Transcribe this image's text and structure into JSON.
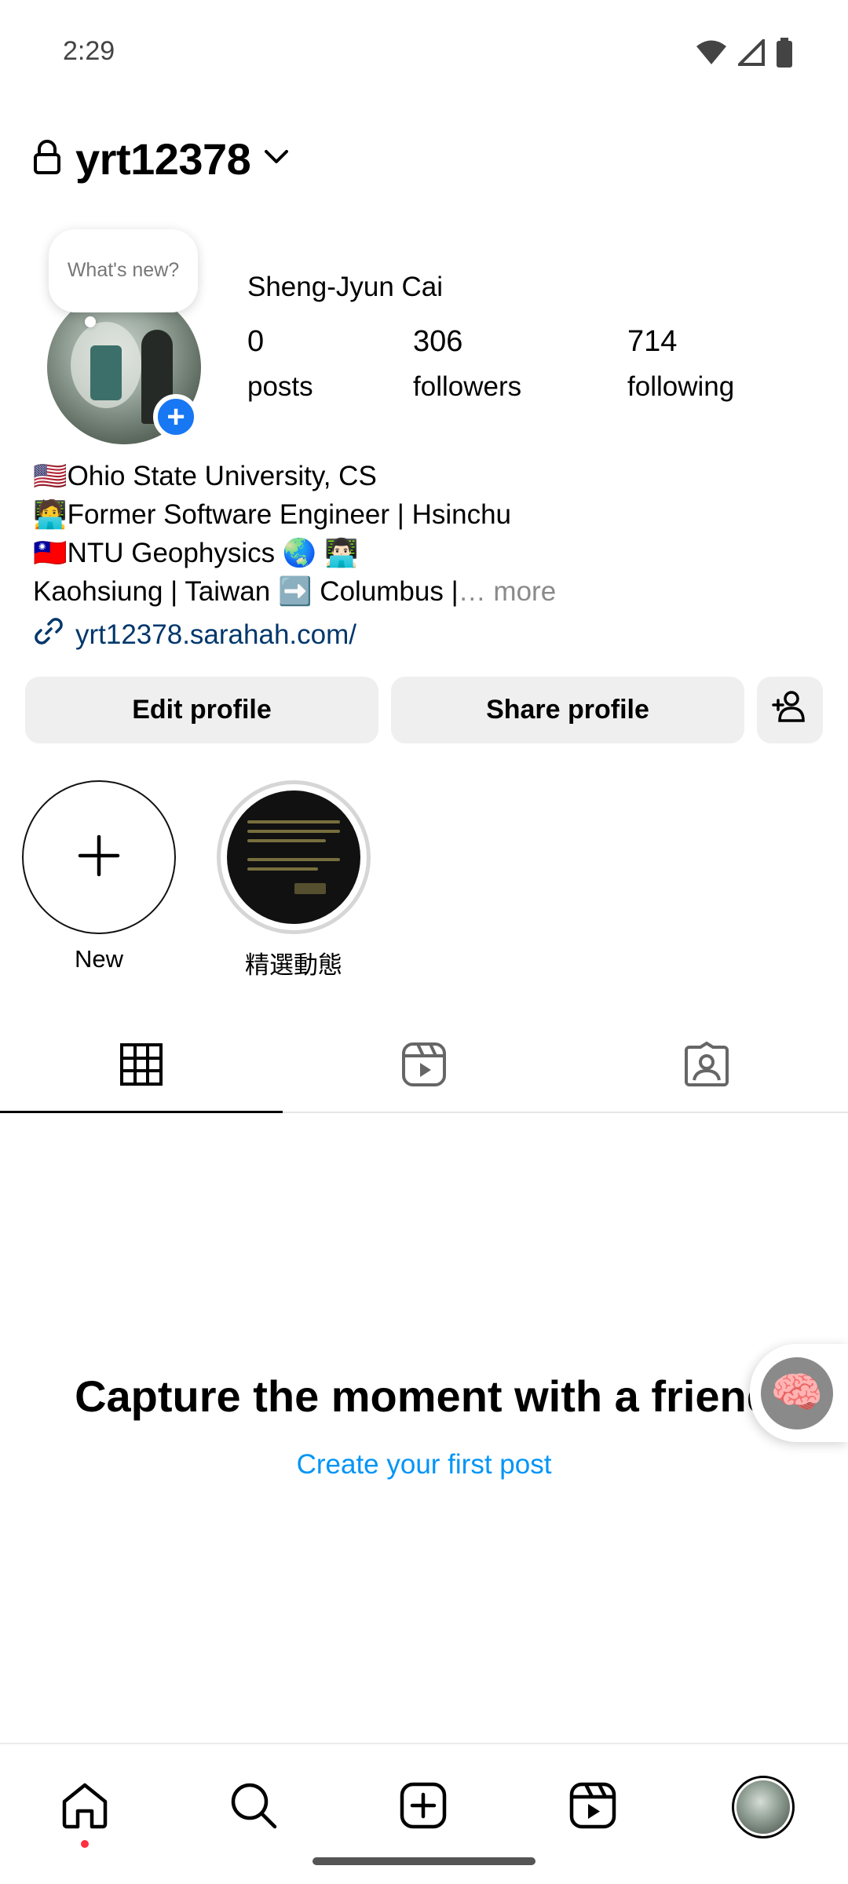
{
  "status_bar": {
    "time": "2:29"
  },
  "header": {
    "username": "yrt12378"
  },
  "profile": {
    "note": "What's new?",
    "display_name": "Sheng-Jyun Cai",
    "stats": [
      {
        "number": "0",
        "label": "posts"
      },
      {
        "number": "306",
        "label": "followers"
      },
      {
        "number": "714",
        "label": "following"
      }
    ]
  },
  "bio": {
    "line1": "🇺🇸Ohio State University, CS",
    "line2": "🧑‍💻Former Software Engineer | Hsinchu",
    "line3": "🇹🇼NTU Geophysics 🌏 👨🏻‍💻",
    "line4": "Kaohsiung | Taiwan ➡️ Columbus |",
    "more": "… more",
    "link": "yrt12378.sarahah.com/"
  },
  "buttons": {
    "edit": "Edit profile",
    "share": "Share profile"
  },
  "highlights": [
    {
      "label": "New"
    },
    {
      "label": "精選動態"
    }
  ],
  "empty_state": {
    "title": "Capture the moment with a friend",
    "cta": "Create your first post"
  },
  "icons": {
    "status": [
      "wifi-icon",
      "signal-icon",
      "battery-icon"
    ],
    "header": [
      "lock-icon",
      "chevron-down-icon"
    ],
    "tabs": [
      "grid-icon",
      "reels-icon",
      "tagged-icon"
    ],
    "nav": [
      "home-icon",
      "search-icon",
      "create-icon",
      "reels-icon",
      "profile-avatar"
    ]
  },
  "colors": {
    "link": "#00376b",
    "cta": "#0095f6",
    "add_badge": "#1877f2",
    "notification_dot": "#ff3040"
  }
}
